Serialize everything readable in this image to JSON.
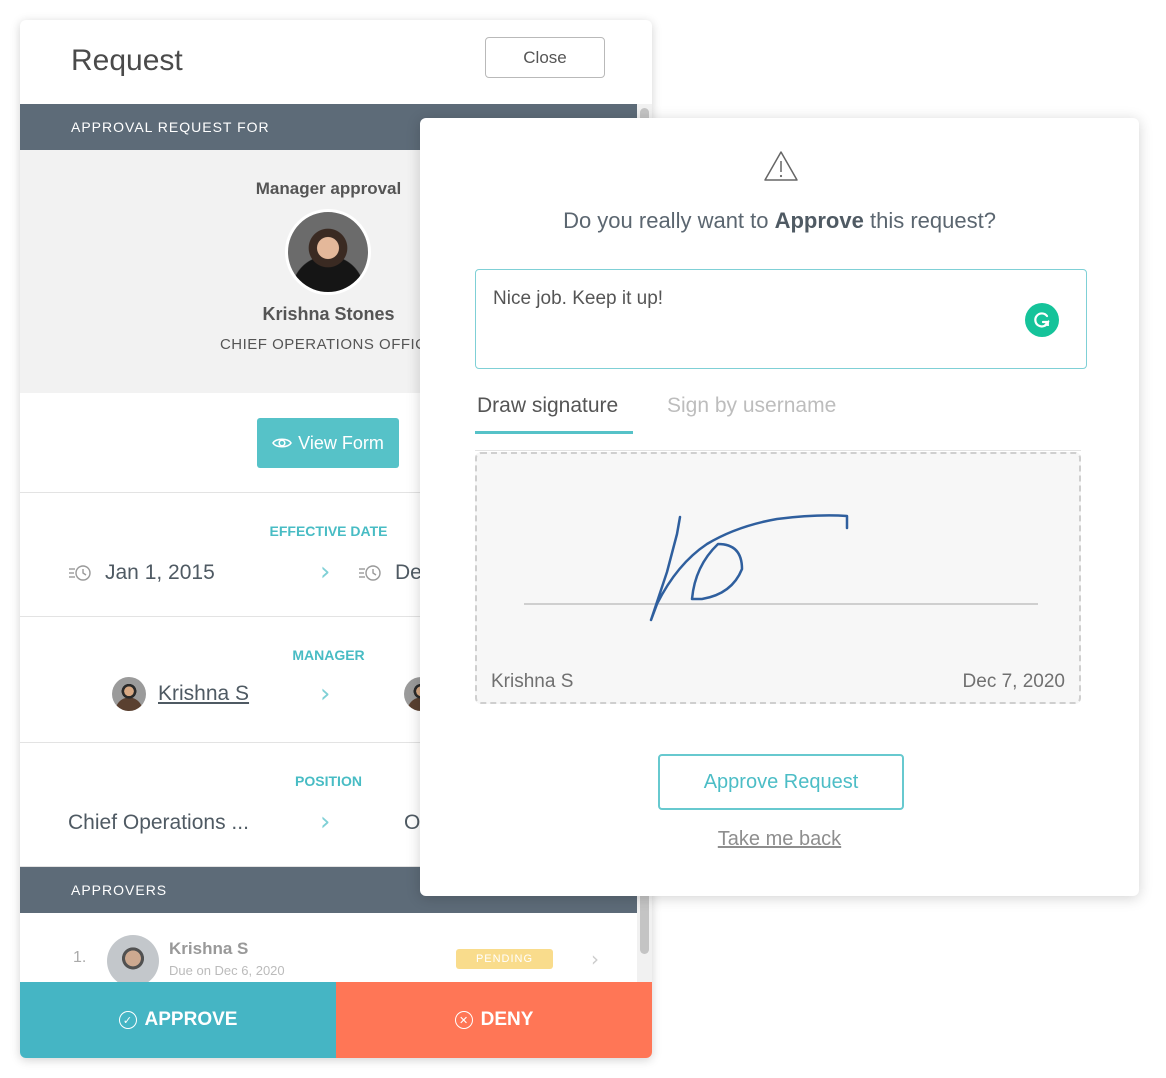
{
  "panel": {
    "title": "Request",
    "close_label": "Close",
    "approval_section_label": "APPROVAL REQUEST FOR",
    "approval_type": "Manager approval",
    "person_name": "Krishna Stones",
    "person_title": "CHIEF OPERATIONS OFFICE",
    "view_form_label": "View Form",
    "fields": [
      {
        "label": "EFFECTIVE DATE",
        "old_value": "Jan 1, 2015",
        "new_value_partial": "De",
        "icon": "clock-history-icon"
      },
      {
        "label": "MANAGER",
        "old_value": "Krishna S",
        "new_value_partial": "",
        "icon": "avatar"
      },
      {
        "label": "POSITION",
        "old_value": "Chief Operations ...",
        "new_value_partial": "O",
        "icon": ""
      }
    ],
    "approvers_section_label": "APPROVERS",
    "approvers": [
      {
        "index": "1.",
        "name": "Krishna S",
        "due": "Due on Dec 6, 2020",
        "status": "PENDING"
      }
    ],
    "approve_label": "APPROVE",
    "deny_label": "DENY"
  },
  "dialog": {
    "question_prefix": "Do you really want to ",
    "question_bold": "Approve",
    "question_suffix": " this request?",
    "comment_value": "Nice job. Keep it up!",
    "tabs": [
      {
        "label": "Draw signature",
        "active": true
      },
      {
        "label": "Sign by username",
        "active": false
      }
    ],
    "signature_name": "Krishna S",
    "signature_date": "Dec 7, 2020",
    "approve_request_label": "Approve Request",
    "take_back_label": "Take me back"
  },
  "colors": {
    "accent_teal": "#56c2c8",
    "approve_bg": "#45b5c4",
    "deny_bg": "#ff7656",
    "section_bar": "#5d6b78",
    "pending_badge": "#f9dc8c",
    "signature_ink": "#2f5f9e",
    "grammarly": "#15c39a"
  }
}
